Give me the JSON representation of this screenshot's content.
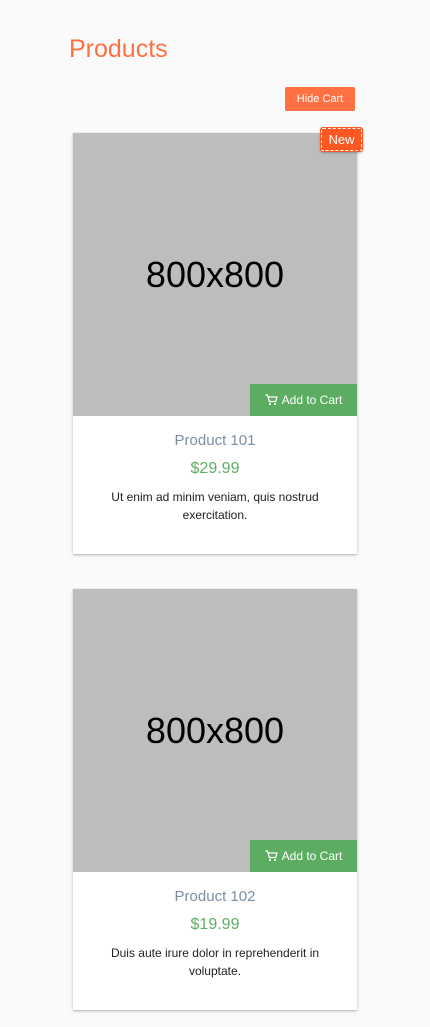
{
  "page": {
    "title": "Products"
  },
  "toolbar": {
    "hide_cart_label": "Hide Cart"
  },
  "products": [
    {
      "image_label": "800x800",
      "add_to_cart_label": "Add to Cart",
      "name": "Product 101",
      "price": "$29.99",
      "description": "Ut enim ad minim veniam, quis nostrud exercitation.",
      "badge": "New"
    },
    {
      "image_label": "800x800",
      "add_to_cart_label": "Add to Cart",
      "name": "Product 102",
      "price": "$19.99",
      "description": "Duis aute irure dolor in reprehenderit in voluptate."
    }
  ],
  "icons": {
    "cart": "shopping-cart-icon"
  },
  "colors": {
    "accent": "#ff7043",
    "badge": "#ff5722",
    "success": "#5cad62",
    "placeholder": "#bdbdbd",
    "product_name": "#7b8fa3"
  }
}
